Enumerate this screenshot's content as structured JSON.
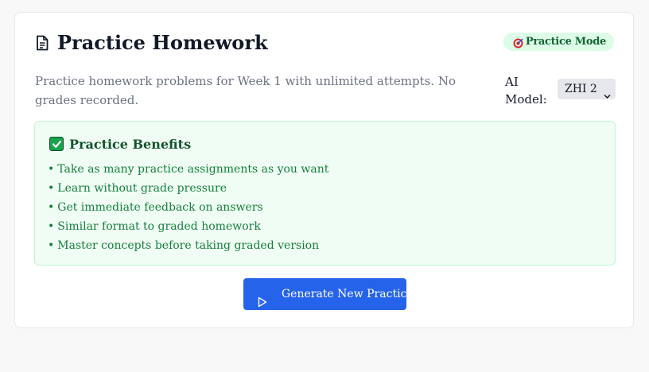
{
  "header": {
    "title": "Practice Homework",
    "title_icon": "document-icon",
    "badge": {
      "label": "Practice Mode",
      "icon": "target-icon"
    }
  },
  "description": "Practice homework problems for Week 1 with unlimited attempts. No grades recorded.",
  "model": {
    "label": "AI Model:",
    "selected": "ZHI 2"
  },
  "benefits": {
    "title": "Practice Benefits",
    "icon": "check-mark-icon",
    "items": [
      "Take as many practice assignments as you want",
      "Learn without grade pressure",
      "Get immediate feedback on answers",
      "Similar format to graded homework",
      "Master concepts before taking graded version"
    ]
  },
  "generate_button": {
    "label": "Generate New Practice",
    "icon": "play-icon"
  },
  "colors": {
    "accent": "#2563eb",
    "badge_bg": "#dcfce7",
    "benefits_bg": "#f0fdf4",
    "benefits_text": "#15803d"
  }
}
